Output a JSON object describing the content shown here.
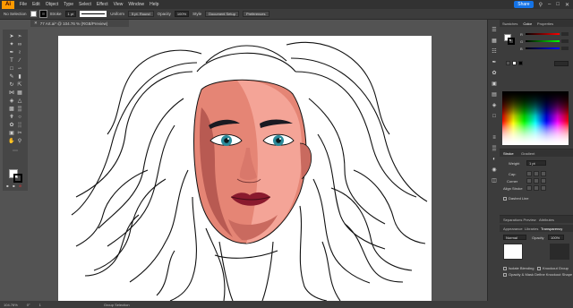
{
  "menubar": {
    "logo": "Ai",
    "items": [
      "File",
      "Edit",
      "Object",
      "Type",
      "Select",
      "Effect",
      "View",
      "Window",
      "Help"
    ],
    "share_label": "Share"
  },
  "controlbar": {
    "selection_label": "No Selection",
    "stroke_label": "Stroke",
    "stroke_weight": "1 pt",
    "profile_label": "Uniform",
    "brush_label": "5 pt. Round",
    "opacity_label": "Opacity",
    "opacity_value": "100%",
    "style_label": "Style",
    "document_setup_label": "Document Setup",
    "preferences_label": "Preferences"
  },
  "document": {
    "tab_title": "77 Art.ai* @ 104.76 % (RGB/Preview)"
  },
  "statusbar": {
    "zoom": "104.76%",
    "rotation": "0°",
    "artboard": "1",
    "tool": "Group Selection"
  },
  "panels": {
    "top_tabs": [
      "Swatches",
      "Color",
      "Properties"
    ],
    "active_top_tab": "Color",
    "color_channels": [
      "R",
      "G",
      "B"
    ],
    "stroke_tabs": [
      "Stroke",
      "Gradient"
    ],
    "weight_label": "Weight",
    "weight_value": "1 pt",
    "corner_label": "Corner",
    "align_label": "Align Stroke",
    "dashed_label": "Dashed Line",
    "sep_tabs": [
      "Separations Preview",
      "Attributes"
    ],
    "transparency_tabs": [
      "Appearance",
      "Libraries",
      "Transparency"
    ],
    "blend_mode": "Normal",
    "opacity_label": "Opacity",
    "opacity_value": "100%",
    "isolate_label": "Isolate Blending",
    "knockout_label": "Knockout Group",
    "opacity_mask_label": "Opacity & Mask Define Knockout Shape"
  },
  "colors": {
    "accent": "#1473e6",
    "skin_light": "#f4a497",
    "skin_mid": "#e58575",
    "skin_dark": "#b85a52",
    "lips": "#8a1a2e",
    "eyes": "#2a8a9a",
    "brows": "#1a1a22"
  }
}
